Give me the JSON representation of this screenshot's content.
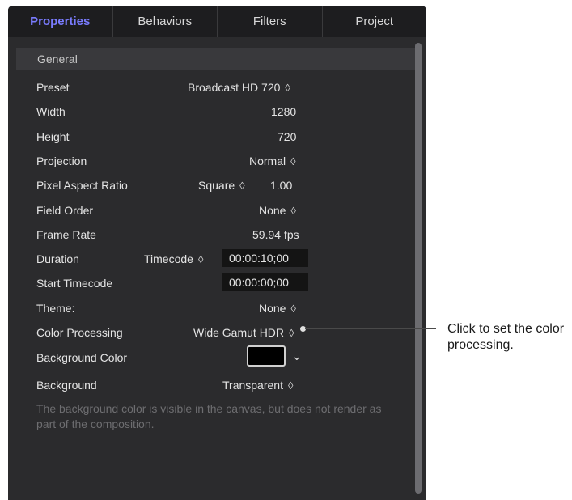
{
  "tabs": [
    {
      "label": "Properties"
    },
    {
      "label": "Behaviors"
    },
    {
      "label": "Filters"
    },
    {
      "label": "Project"
    }
  ],
  "section": {
    "title": "General"
  },
  "rows": {
    "preset": {
      "label": "Preset",
      "value": "Broadcast HD 720"
    },
    "width": {
      "label": "Width",
      "value": "1280"
    },
    "height": {
      "label": "Height",
      "value": "720"
    },
    "projection": {
      "label": "Projection",
      "value": "Normal"
    },
    "pixel_aspect": {
      "label": "Pixel Aspect Ratio",
      "value": "Square",
      "ratio": "1.00"
    },
    "field_order": {
      "label": "Field Order",
      "value": "None"
    },
    "frame_rate": {
      "label": "Frame Rate",
      "value": "59.94 fps"
    },
    "duration": {
      "label": "Duration",
      "format": "Timecode",
      "value": "00:00:10;00"
    },
    "start_timecode": {
      "label": "Start Timecode",
      "value": "00:00:00;00"
    },
    "theme": {
      "label": "Theme:",
      "value": "None"
    },
    "color_processing": {
      "label": "Color Processing",
      "value": "Wide Gamut HDR"
    },
    "background_color": {
      "label": "Background Color",
      "swatch": "#000000"
    },
    "background": {
      "label": "Background",
      "value": "Transparent"
    }
  },
  "note": "The background color is visible in the canvas, but does not render as part of the composition.",
  "callout": "Click to set the color processing.",
  "icons": {
    "stepper": "⌃⌄ up-down-chevron-icon",
    "chevron_down": "chevron-down-icon"
  },
  "colors": {
    "accent": "#7a7cff",
    "panel": "#2b2b2d",
    "tabbar": "#1d1d1f"
  }
}
